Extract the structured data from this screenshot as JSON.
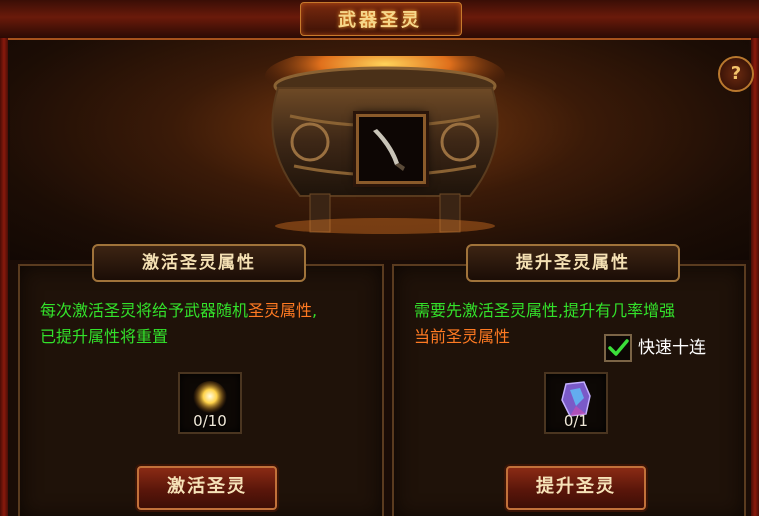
{
  "window": {
    "title": "武器圣灵",
    "help_label": "?"
  },
  "scene": {
    "weapon_slot_icon": "curved-sword-icon"
  },
  "left_panel": {
    "header": "激活圣灵属性",
    "desc_part1": "每次激活圣灵将给予武器随机",
    "desc_highlight": "圣灵属性",
    "desc_part2": ",",
    "desc_line2": "已提升属性将重置",
    "item_icon": "glowing-orb-icon",
    "item_count": "0/10",
    "button_label": "激活圣灵"
  },
  "right_panel": {
    "header": "提升圣灵属性",
    "desc_line1": "需要先激活圣灵属性,提升有几率增强",
    "desc_line2": "当前圣灵属性",
    "quick_checked": true,
    "quick_label": "快速十连",
    "item_icon": "crystal-gem-icon",
    "item_count": "0/1",
    "button_label": "提升圣灵"
  },
  "colors": {
    "green_text": "#33e22b",
    "orange_text": "#ff7a22",
    "title_gold": "#f6d78a"
  }
}
